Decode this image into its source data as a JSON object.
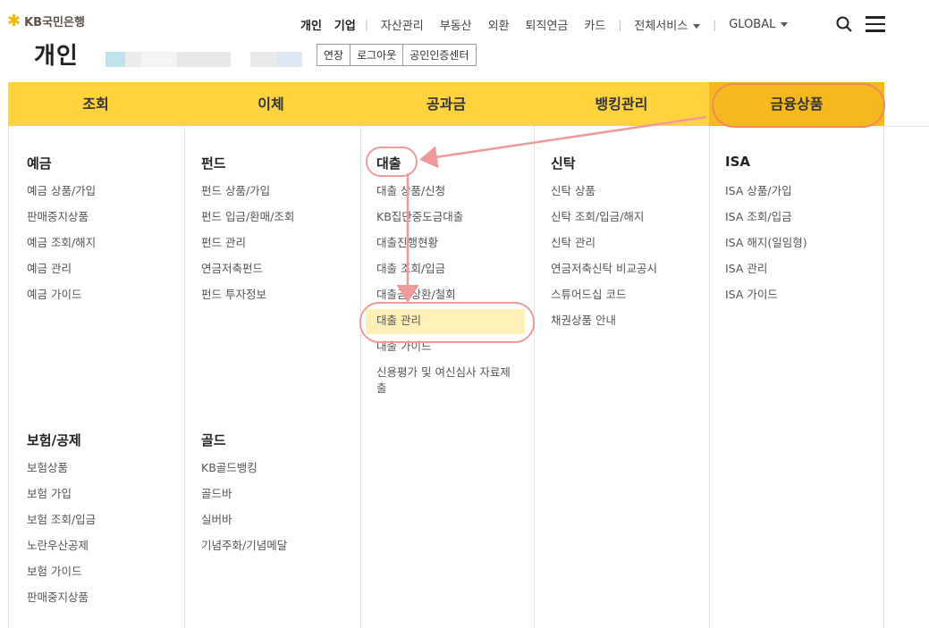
{
  "brand": {
    "logo_text": "KB국민은행"
  },
  "topnav": {
    "items": [
      "개인",
      "기업",
      "자산관리",
      "부동산",
      "외환",
      "퇴직연금",
      "카드",
      "전체서비스",
      "GLOBAL"
    ]
  },
  "page": {
    "title": "개인",
    "buttons": [
      "연장",
      "로그아웃",
      "공인인증센터"
    ]
  },
  "mainnav": {
    "tabs": [
      "조회",
      "이체",
      "공과금",
      "뱅킹관리",
      "금융상품"
    ],
    "active": "금융상품"
  },
  "menu": {
    "deposit": {
      "head": "예금",
      "links": [
        "예금 상품/가입",
        "판매중지상품",
        "예금 조회/해지",
        "예금 관리",
        "예금 가이드"
      ]
    },
    "fund": {
      "head": "펀드",
      "links": [
        "펀드 상품/가입",
        "펀드 입금/환매/조회",
        "펀드 관리",
        "연금저축펀드",
        "펀드 투자정보"
      ]
    },
    "loan": {
      "head": "대출",
      "links": [
        "대출 상품/신청",
        "KB집단중도금대출",
        "대출진행현황",
        "대출 조회/입금",
        "대출금 상환/철회",
        "대출 관리",
        "대출 가이드",
        "신용평가 및 여신심사 자료제출"
      ]
    },
    "trust": {
      "head": "신탁",
      "links": [
        "신탁 상품",
        "신탁 조회/입금/해지",
        "신탁 관리",
        "연금저축신탁 비교공시",
        "스튜어드십 코드",
        "채권상품 안내"
      ]
    },
    "isa": {
      "head": "ISA",
      "links": [
        "ISA 상품/가입",
        "ISA 조회/입금",
        "ISA 해지(일임형)",
        "ISA 관리",
        "ISA 가이드"
      ]
    },
    "insurance": {
      "head": "보험/공제",
      "links": [
        "보험상품",
        "보험 가입",
        "보험 조회/입금",
        "노란우산공제",
        "보험 가이드",
        "판매중지상품"
      ]
    },
    "gold": {
      "head": "골드",
      "links": [
        "KB골드뱅킹",
        "골드바",
        "실버바",
        "기념주화/기념메달"
      ]
    }
  },
  "colors": {
    "nav_yellow": "#ffd33d",
    "active_tab": "#f6b81f",
    "highlight": "#fff0b8",
    "annotation": "#ef9a9a"
  }
}
